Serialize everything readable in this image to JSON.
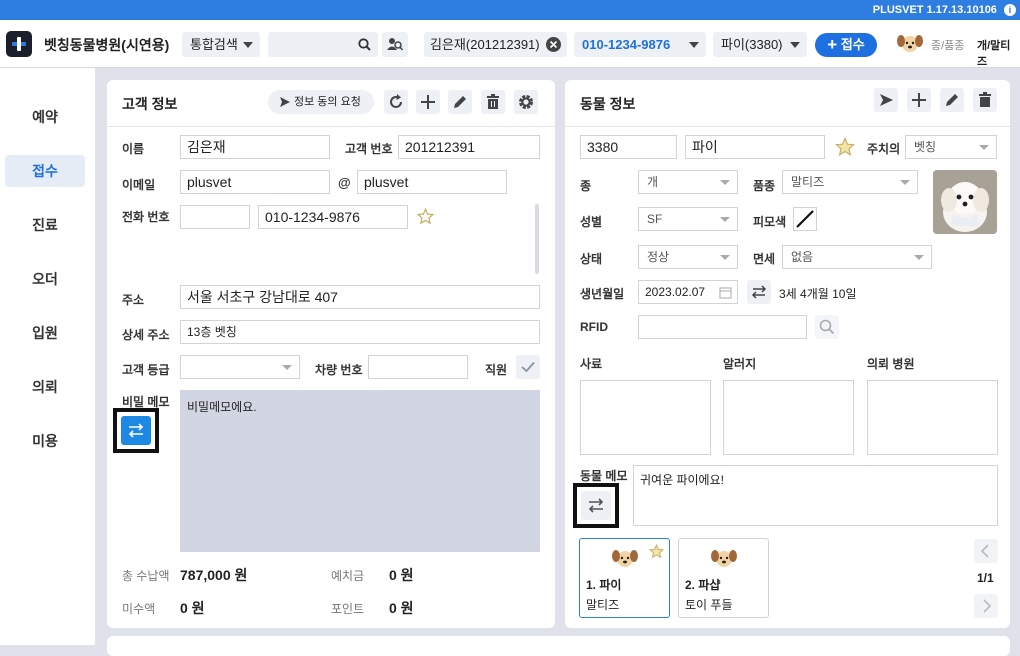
{
  "app": {
    "brand": "PLUSVET",
    "version": "1.17.13.10106"
  },
  "header": {
    "hospital_name": "벳칭동물병원(시연용)",
    "search_type": "통합검색",
    "search_value": "",
    "current_customer": "김은재(201212391)",
    "phone": "010-1234-9876",
    "pet": "파이(3380)",
    "reception_button": "접수",
    "species_label": "종/품종",
    "species_value": "개/말티즈"
  },
  "nav": [
    "예약",
    "접수",
    "진료",
    "오더",
    "입원",
    "의뢰",
    "미용"
  ],
  "nav_active": "접수",
  "customer": {
    "title": "고객 정보",
    "consent_button": "정보 동의 요청",
    "name_label": "이름",
    "name": "김은재",
    "number_label": "고객 번호",
    "number": "201212391",
    "email_label": "이메일",
    "email_user": "plusvet",
    "at": "@",
    "email_domain": "plusvet",
    "phone_label": "전화 번호",
    "phone_prefix": "",
    "phone": "010-1234-9876",
    "address_label": "주소",
    "address": "서울 서초구 강남대로 407",
    "detail_label": "상세 주소",
    "detail": "13층 벳칭",
    "grade_label": "고객 등급",
    "grade": "",
    "car_label": "차량 번호",
    "car": "",
    "staff_label": "직원",
    "secret_label": "비밀 메모",
    "secret_memo": "비밀메모에요.",
    "total_label": "총 수납액",
    "total": "787,000 원",
    "deposit_label": "예치금",
    "deposit": "0 원",
    "unpaid_label": "미수액",
    "unpaid": "0 원",
    "point_label": "포인트",
    "point": "0 원"
  },
  "animal": {
    "title": "동물 정보",
    "id": "3380",
    "name": "파이",
    "caution_label": "주치의",
    "caution": "벳칭",
    "species_label": "종",
    "species": "개",
    "breed_label": "품종",
    "breed": "말티즈",
    "sex_label": "성별",
    "sex": "SF",
    "coat_label": "피모색",
    "status_label": "상태",
    "status": "정상",
    "immunity_label": "면세",
    "immunity": "없음",
    "birth_label": "생년월일",
    "birth": "2023.02.07",
    "age": "3세 4개월 10일",
    "rfid_label": "RFID",
    "rfid": "",
    "feed_label": "사료",
    "allergy_label": "알러지",
    "referral_label": "의뢰 병원",
    "memo_label": "동물 메모",
    "memo": "귀여운 파이에요!",
    "pets": [
      {
        "title": "1. 파이",
        "breed": "말티즈"
      },
      {
        "title": "2. 파샵",
        "breed": "토이 푸들"
      }
    ],
    "page": "1/1"
  },
  "colors": {
    "accent": "#1e6fe0",
    "topbar": "#2e7de1",
    "memo_bg": "#d2d5e2"
  }
}
